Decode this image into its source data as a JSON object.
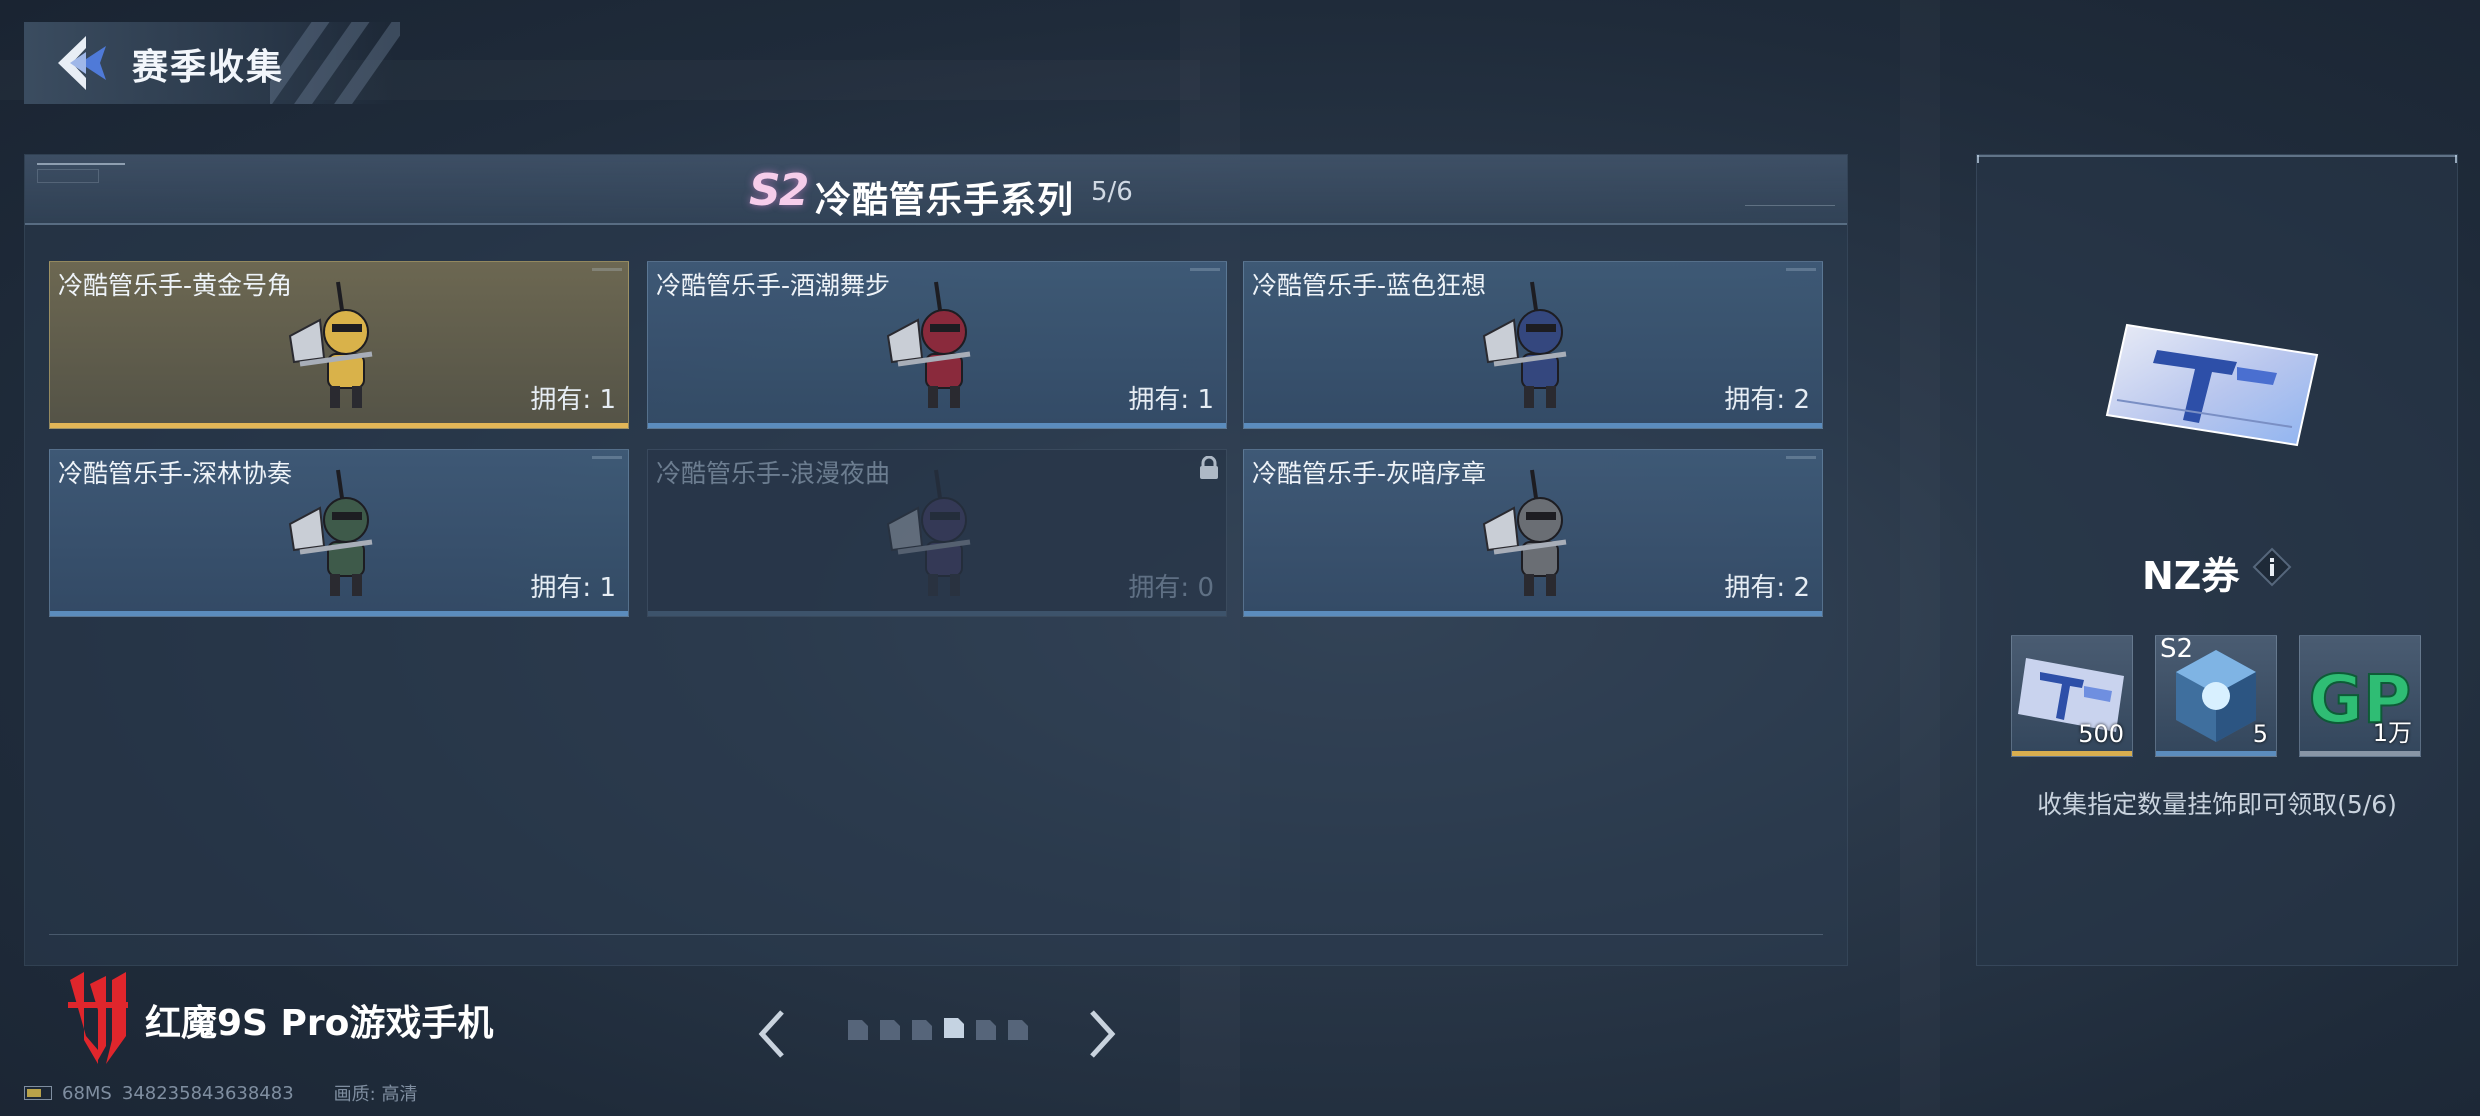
{
  "header": {
    "title": "赛季收集"
  },
  "series": {
    "season_badge": "S2",
    "title": "冷酷管乐手系列",
    "progress": "5/6"
  },
  "cards": [
    {
      "name": "冷酷管乐手-黄金号角",
      "owned": "拥有: 1",
      "rarity": "gold",
      "body_color": "#d9b24a",
      "locked": false
    },
    {
      "name": "冷酷管乐手-酒潮舞步",
      "owned": "拥有: 1",
      "rarity": "blue",
      "body_color": "#8a2a3c",
      "locked": false
    },
    {
      "name": "冷酷管乐手-蓝色狂想",
      "owned": "拥有: 2",
      "rarity": "blue",
      "body_color": "#34477e",
      "locked": false
    },
    {
      "name": "冷酷管乐手-深林协奏",
      "owned": "拥有: 1",
      "rarity": "blue",
      "body_color": "#3e5a4a",
      "locked": false
    },
    {
      "name": "冷酷管乐手-浪漫夜曲",
      "owned": "拥有: 0",
      "rarity": "blue",
      "body_color": "#4a3e6e",
      "locked": true
    },
    {
      "name": "冷酷管乐手-灰暗序章",
      "owned": "拥有: 2",
      "rarity": "blue",
      "body_color": "#6a6e74",
      "locked": false
    }
  ],
  "reward_panel": {
    "ticket_name": "NZ券",
    "info_icon": "info-icon",
    "rewards": [
      {
        "item": "NZ券",
        "count": "500",
        "bar_color": "#d8ae4f"
      },
      {
        "item": "S2",
        "tag": "S2",
        "count": "5",
        "bar_color": "#5b8cbd"
      },
      {
        "item": "GP",
        "count": "1万",
        "bar_color": "#8996a6"
      }
    ],
    "description": "收集指定数量挂饰即可领取(5/6)"
  },
  "pager": {
    "total_pages": 6,
    "current_page": 4
  },
  "brand": {
    "text": "红魔9S Pro游戏手机"
  },
  "footer": {
    "ping": "68MS",
    "player_id": "348235843638483",
    "quality": "画质: 高清"
  },
  "colors": {
    "gold": "#e2b657",
    "blue": "#5b8cbd",
    "season_pink": "#f6cdea",
    "brand_red": "#e0262c"
  }
}
